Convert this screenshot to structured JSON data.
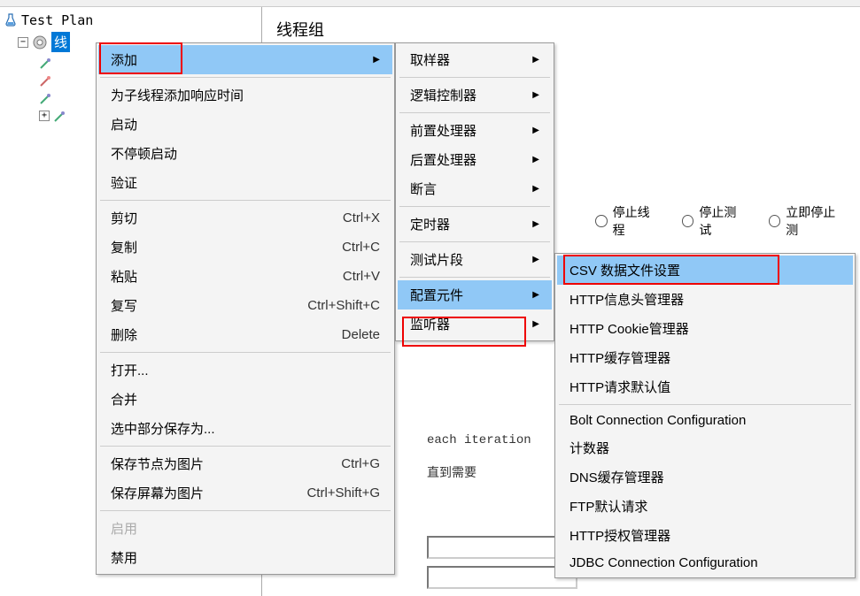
{
  "tree": {
    "root": "Test Plan",
    "selected": "线"
  },
  "detail": {
    "title": "线程组",
    "radio1": "停止线程",
    "radio2": "停止测试",
    "radio3": "立即停止测",
    "iteration_label": "each iteration",
    "until_label": "直到需要"
  },
  "menu1": {
    "add": "添加",
    "add_response_time": "为子线程添加响应时间",
    "start": "启动",
    "start_nopause": "不停顿启动",
    "validate": "验证",
    "cut": "剪切",
    "cut_sc": "Ctrl+X",
    "copy": "复制",
    "copy_sc": "Ctrl+C",
    "paste": "粘贴",
    "paste_sc": "Ctrl+V",
    "duplicate": "复写",
    "duplicate_sc": "Ctrl+Shift+C",
    "delete": "删除",
    "delete_sc": "Delete",
    "open": "打开...",
    "merge": "合并",
    "save_selection": "选中部分保存为...",
    "save_node_img": "保存节点为图片",
    "save_node_img_sc": "Ctrl+G",
    "save_screen_img": "保存屏幕为图片",
    "save_screen_img_sc": "Ctrl+Shift+G",
    "enable": "启用",
    "disable": "禁用"
  },
  "menu2": {
    "sampler": "取样器",
    "logic": "逻辑控制器",
    "preproc": "前置处理器",
    "postproc": "后置处理器",
    "assert": "断言",
    "timer": "定时器",
    "fragment": "测试片段",
    "config": "配置元件",
    "listener": "监听器"
  },
  "menu3": {
    "csv": "CSV 数据文件设置",
    "http_header": "HTTP信息头管理器",
    "http_cookie": "HTTP Cookie管理器",
    "http_cache": "HTTP缓存管理器",
    "http_defaults": "HTTP请求默认值",
    "bolt": "Bolt Connection Configuration",
    "counter": "计数器",
    "dns": "DNS缓存管理器",
    "ftp": "FTP默认请求",
    "http_auth": "HTTP授权管理器",
    "jdbc": "JDBC Connection Configuration"
  }
}
